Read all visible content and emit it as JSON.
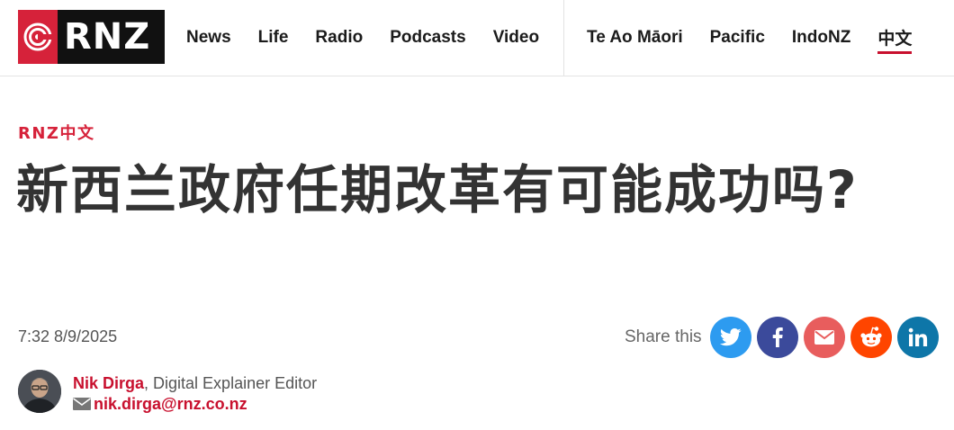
{
  "brand": {
    "logo_text": "RNZ",
    "accent": "#d6223a"
  },
  "nav": {
    "main": [
      "News",
      "Life",
      "Radio",
      "Podcasts",
      "Video"
    ],
    "secondary": [
      "Te Ao Māori",
      "Pacific",
      "IndoNZ",
      "中文"
    ],
    "active": "中文"
  },
  "article": {
    "kicker": "RNZ中文",
    "headline": "新西兰政府任期改革有可能成功吗?",
    "timestamp": "7:32 8/9/2025"
  },
  "share": {
    "label": "Share this",
    "buttons": [
      {
        "icon": "twitter-icon",
        "color": "#2d9bf0"
      },
      {
        "icon": "facebook-icon",
        "color": "#3b4a9b"
      },
      {
        "icon": "mail-icon",
        "color": "#e85d5d"
      },
      {
        "icon": "reddit-icon",
        "color": "#ff4500"
      },
      {
        "icon": "linkedin-icon",
        "color": "#0e76a8"
      }
    ]
  },
  "author": {
    "name": "Nik Dirga",
    "role": ", Digital Explainer Editor",
    "email": "nik.dirga@rnz.co.nz"
  }
}
